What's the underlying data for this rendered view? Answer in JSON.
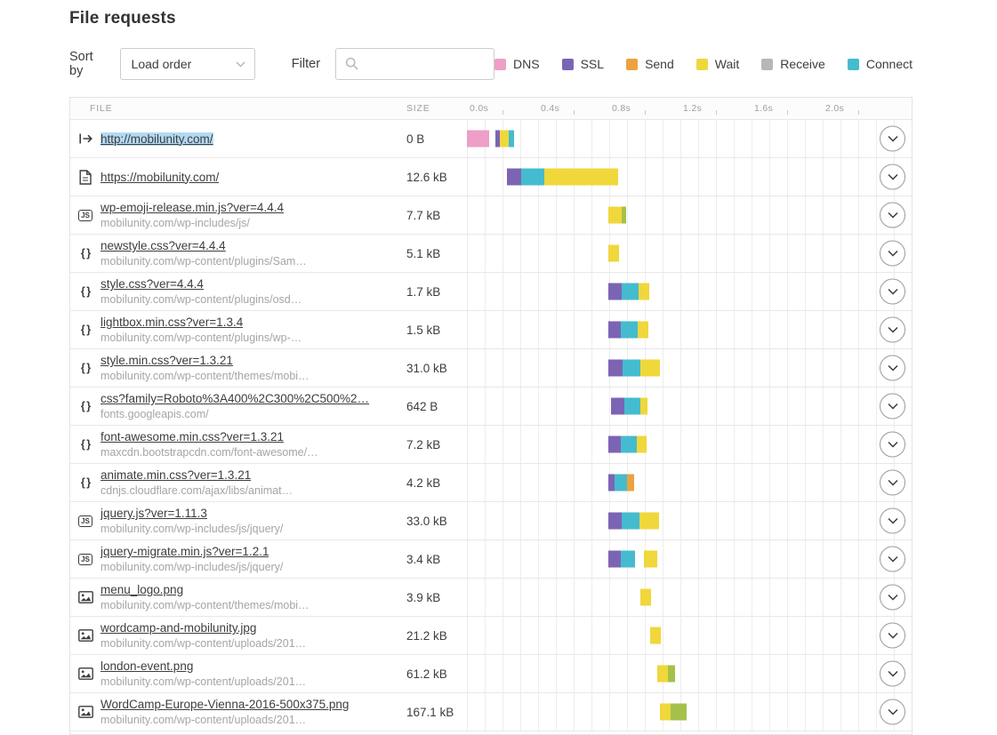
{
  "page": {
    "title": "File requests"
  },
  "controls": {
    "sort_label": "Sort by",
    "sort_value": "Load order",
    "filter_label": "Filter",
    "filter_value": ""
  },
  "legend": [
    {
      "label": "DNS",
      "color": "#ee9fc7"
    },
    {
      "label": "SSL",
      "color": "#7c64b4"
    },
    {
      "label": "Send",
      "color": "#eba33f"
    },
    {
      "label": "Wait",
      "color": "#f0d73b"
    },
    {
      "label": "Receive",
      "color": "#b7b7b7"
    },
    {
      "label": "Connect",
      "color": "#45bbcf"
    }
  ],
  "icons": {
    "js_glyph": "JS",
    "css_glyph": "{ }"
  },
  "table": {
    "col_file": "FILE",
    "col_size": "SIZE"
  },
  "chart_data": {
    "type": "waterfall-timeline",
    "unit": "seconds",
    "time_axis": {
      "max": 2.5,
      "ticks": [
        {
          "label": "0.0s",
          "t": 0.0
        },
        {
          "label": "0.4s",
          "t": 0.4
        },
        {
          "label": "0.8s",
          "t": 0.8
        },
        {
          "label": "1.2s",
          "t": 1.2
        },
        {
          "label": "1.6s",
          "t": 1.6
        },
        {
          "label": "2.0s",
          "t": 2.0
        }
      ],
      "minor_ticks": [
        0.2,
        0.6,
        1.0,
        1.4,
        1.8,
        2.2
      ]
    },
    "phases": {
      "dns": "#ee9fc7",
      "ssl": "#7c64b4",
      "connect": "#45bbcf",
      "send": "#eba33f",
      "wait": "#f0d73b",
      "receive": "#a4c14b"
    },
    "rows": [
      {
        "icon": "redirect",
        "name": "http://mobilunity.com/",
        "sub": "",
        "size": "0 B",
        "selected": true,
        "segments": [
          {
            "phase": "dns",
            "start": 0.0,
            "end": 0.125
          },
          {
            "phase": "ssl",
            "start": 0.16,
            "end": 0.185
          },
          {
            "phase": "wait",
            "start": 0.185,
            "end": 0.235
          },
          {
            "phase": "connect",
            "start": 0.235,
            "end": 0.265
          }
        ]
      },
      {
        "icon": "document",
        "name": "https://mobilunity.com/",
        "sub": "",
        "size": "12.6 kB",
        "segments": [
          {
            "phase": "ssl",
            "start": 0.225,
            "end": 0.305
          },
          {
            "phase": "connect",
            "start": 0.305,
            "end": 0.435
          },
          {
            "phase": "wait",
            "start": 0.435,
            "end": 0.85
          }
        ]
      },
      {
        "icon": "js",
        "name": "wp-emoji-release.min.js?ver=4.4.4",
        "sub": "mobilunity.com/wp-includes/js/",
        "size": "7.7 kB",
        "segments": [
          {
            "phase": "wait",
            "start": 0.795,
            "end": 0.87
          },
          {
            "phase": "receive",
            "start": 0.87,
            "end": 0.895
          }
        ]
      },
      {
        "icon": "css",
        "name": "newstyle.css?ver=4.4.4",
        "sub": "mobilunity.com/wp-content/plugins/Sam…",
        "size": "5.1 kB",
        "segments": [
          {
            "phase": "wait",
            "start": 0.795,
            "end": 0.855
          }
        ]
      },
      {
        "icon": "css",
        "name": "style.css?ver=4.4.4",
        "sub": "mobilunity.com/wp-content/plugins/osd…",
        "size": "1.7 kB",
        "segments": [
          {
            "phase": "ssl",
            "start": 0.795,
            "end": 0.87
          },
          {
            "phase": "connect",
            "start": 0.87,
            "end": 0.965
          },
          {
            "phase": "wait",
            "start": 0.965,
            "end": 1.025
          }
        ]
      },
      {
        "icon": "css",
        "name": "lightbox.min.css?ver=1.3.4",
        "sub": "mobilunity.com/wp-content/plugins/wp-…",
        "size": "1.5 kB",
        "segments": [
          {
            "phase": "ssl",
            "start": 0.795,
            "end": 0.865
          },
          {
            "phase": "connect",
            "start": 0.865,
            "end": 0.96
          },
          {
            "phase": "wait",
            "start": 0.96,
            "end": 1.02
          }
        ]
      },
      {
        "icon": "css",
        "name": "style.min.css?ver=1.3.21",
        "sub": "mobilunity.com/wp-content/themes/mobi…",
        "size": "31.0 kB",
        "segments": [
          {
            "phase": "ssl",
            "start": 0.795,
            "end": 0.875
          },
          {
            "phase": "connect",
            "start": 0.875,
            "end": 0.975
          },
          {
            "phase": "wait",
            "start": 0.975,
            "end": 1.085
          }
        ]
      },
      {
        "icon": "css",
        "name": "css?family=Roboto%3A400%2C300%2C500%2…",
        "sub": "fonts.googleapis.com/",
        "size": "642 B",
        "segments": [
          {
            "phase": "ssl",
            "start": 0.81,
            "end": 0.885
          },
          {
            "phase": "connect",
            "start": 0.885,
            "end": 0.975
          },
          {
            "phase": "wait",
            "start": 0.975,
            "end": 1.015
          }
        ]
      },
      {
        "icon": "css",
        "name": "font-awesome.min.css?ver=1.3.21",
        "sub": "maxcdn.bootstrapcdn.com/font-awesome/…",
        "size": "7.2 kB",
        "segments": [
          {
            "phase": "ssl",
            "start": 0.795,
            "end": 0.865
          },
          {
            "phase": "connect",
            "start": 0.865,
            "end": 0.955
          },
          {
            "phase": "wait",
            "start": 0.955,
            "end": 1.01
          }
        ]
      },
      {
        "icon": "css",
        "name": "animate.min.css?ver=1.3.21",
        "sub": "cdnjs.cloudflare.com/ajax/libs/animat…",
        "size": "4.2 kB",
        "segments": [
          {
            "phase": "ssl",
            "start": 0.795,
            "end": 0.83
          },
          {
            "phase": "connect",
            "start": 0.83,
            "end": 0.9
          },
          {
            "phase": "send",
            "start": 0.9,
            "end": 0.94
          }
        ]
      },
      {
        "icon": "js",
        "name": "jquery.js?ver=1.11.3",
        "sub": "mobilunity.com/wp-includes/js/jquery/",
        "size": "33.0 kB",
        "segments": [
          {
            "phase": "ssl",
            "start": 0.795,
            "end": 0.87
          },
          {
            "phase": "connect",
            "start": 0.87,
            "end": 0.97
          },
          {
            "phase": "wait",
            "start": 0.97,
            "end": 1.08
          }
        ]
      },
      {
        "icon": "js",
        "name": "jquery-migrate.min.js?ver=1.2.1",
        "sub": "mobilunity.com/wp-includes/js/jquery/",
        "size": "3.4 kB",
        "segments": [
          {
            "phase": "ssl",
            "start": 0.795,
            "end": 0.865
          },
          {
            "phase": "connect",
            "start": 0.865,
            "end": 0.945
          },
          {
            "phase": "wait",
            "start": 0.995,
            "end": 1.07
          }
        ]
      },
      {
        "icon": "image",
        "name": "menu_logo.png",
        "sub": "mobilunity.com/wp-content/themes/mobi…",
        "size": "3.9 kB",
        "segments": [
          {
            "phase": "wait",
            "start": 0.975,
            "end": 1.035
          }
        ]
      },
      {
        "icon": "image",
        "name": "wordcamp-and-mobilunity.jpg",
        "sub": "mobilunity.com/wp-content/uploads/201…",
        "size": "21.2 kB",
        "segments": [
          {
            "phase": "wait",
            "start": 1.03,
            "end": 1.09
          }
        ]
      },
      {
        "icon": "image",
        "name": "london-event.png",
        "sub": "mobilunity.com/wp-content/uploads/201…",
        "size": "61.2 kB",
        "segments": [
          {
            "phase": "wait",
            "start": 1.07,
            "end": 1.13
          },
          {
            "phase": "receive",
            "start": 1.13,
            "end": 1.17
          }
        ]
      },
      {
        "icon": "image",
        "name": "WordCamp-Europe-Vienna-2016-500x375.png",
        "sub": "mobilunity.com/wp-content/uploads/201…",
        "size": "167.1 kB",
        "segments": [
          {
            "phase": "wait",
            "start": 1.085,
            "end": 1.145
          },
          {
            "phase": "receive",
            "start": 1.145,
            "end": 1.235
          }
        ]
      }
    ]
  }
}
